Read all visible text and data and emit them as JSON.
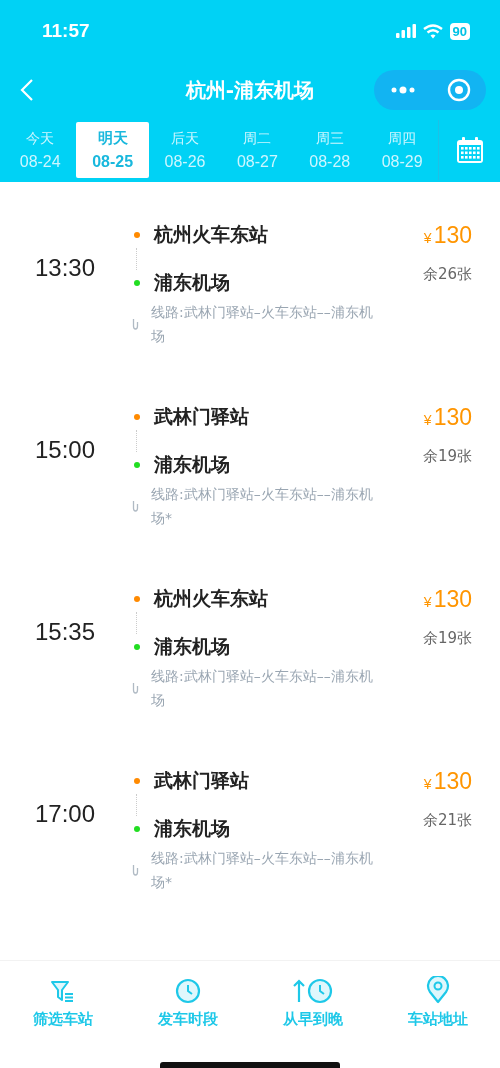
{
  "status_bar": {
    "time": "11:57",
    "battery": "90"
  },
  "nav": {
    "title": "杭州-浦东机场"
  },
  "dates": [
    {
      "day": "今天",
      "date": "08-24",
      "selected": false
    },
    {
      "day": "明天",
      "date": "08-25",
      "selected": true
    },
    {
      "day": "后天",
      "date": "08-26",
      "selected": false
    },
    {
      "day": "周二",
      "date": "08-27",
      "selected": false
    },
    {
      "day": "周三",
      "date": "08-28",
      "selected": false
    },
    {
      "day": "周四",
      "date": "08-29",
      "selected": false
    }
  ],
  "trips": [
    {
      "time": "13:30",
      "from": "杭州火车东站",
      "to": "浦东机场",
      "currency": "¥",
      "price": "130",
      "remaining": "余26张",
      "route": "线路:武林门驿站–火车东站––浦东机场"
    },
    {
      "time": "15:00",
      "from": "武林门驿站",
      "to": "浦东机场",
      "currency": "¥",
      "price": "130",
      "remaining": "余19张",
      "route": "线路:武林门驿站–火车东站––浦东机场*"
    },
    {
      "time": "15:35",
      "from": "杭州火车东站",
      "to": "浦东机场",
      "currency": "¥",
      "price": "130",
      "remaining": "余19张",
      "route": "线路:武林门驿站–火车东站––浦东机场"
    },
    {
      "time": "17:00",
      "from": "武林门驿站",
      "to": "浦东机场",
      "currency": "¥",
      "price": "130",
      "remaining": "余21张",
      "route": "线路:武林门驿站–火车东站––浦东机场*"
    }
  ],
  "toolbar": [
    {
      "kind": "filter",
      "label": "筛选车站"
    },
    {
      "kind": "clock",
      "label": "发车时段"
    },
    {
      "kind": "sort",
      "label": "从早到晚"
    },
    {
      "kind": "pin",
      "label": "车站地址"
    }
  ]
}
